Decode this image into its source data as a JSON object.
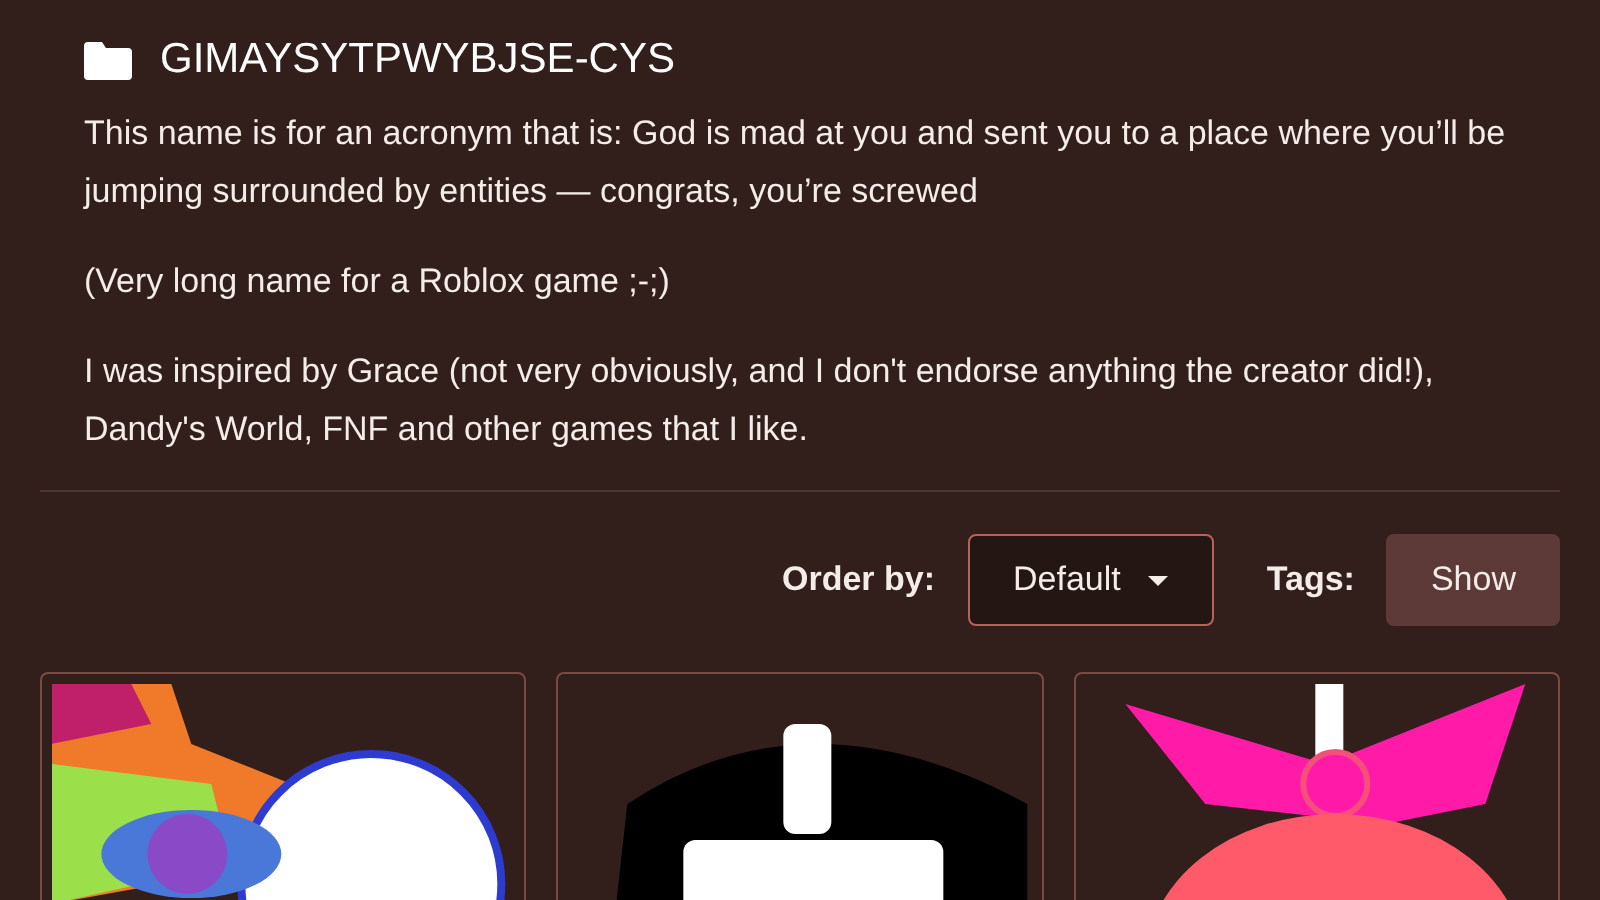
{
  "title": "GIMAYSYTPWYBJSE-CYS",
  "paragraphs": [
    "This name is for an acronym that is: God is mad at you and sent you to a place where you’ll be jumping surrounded by entities — congrats, you’re screwed",
    "(Very long name for a Roblox game ;-;)",
    "I was inspired by Grace (not very obviously, and I don't endorse anything the creator did!), Dandy's World, FNF and other games that I like."
  ],
  "order_by": {
    "label": "Order by:",
    "value": "Default"
  },
  "tags": {
    "label": "Tags:",
    "button": "Show"
  }
}
